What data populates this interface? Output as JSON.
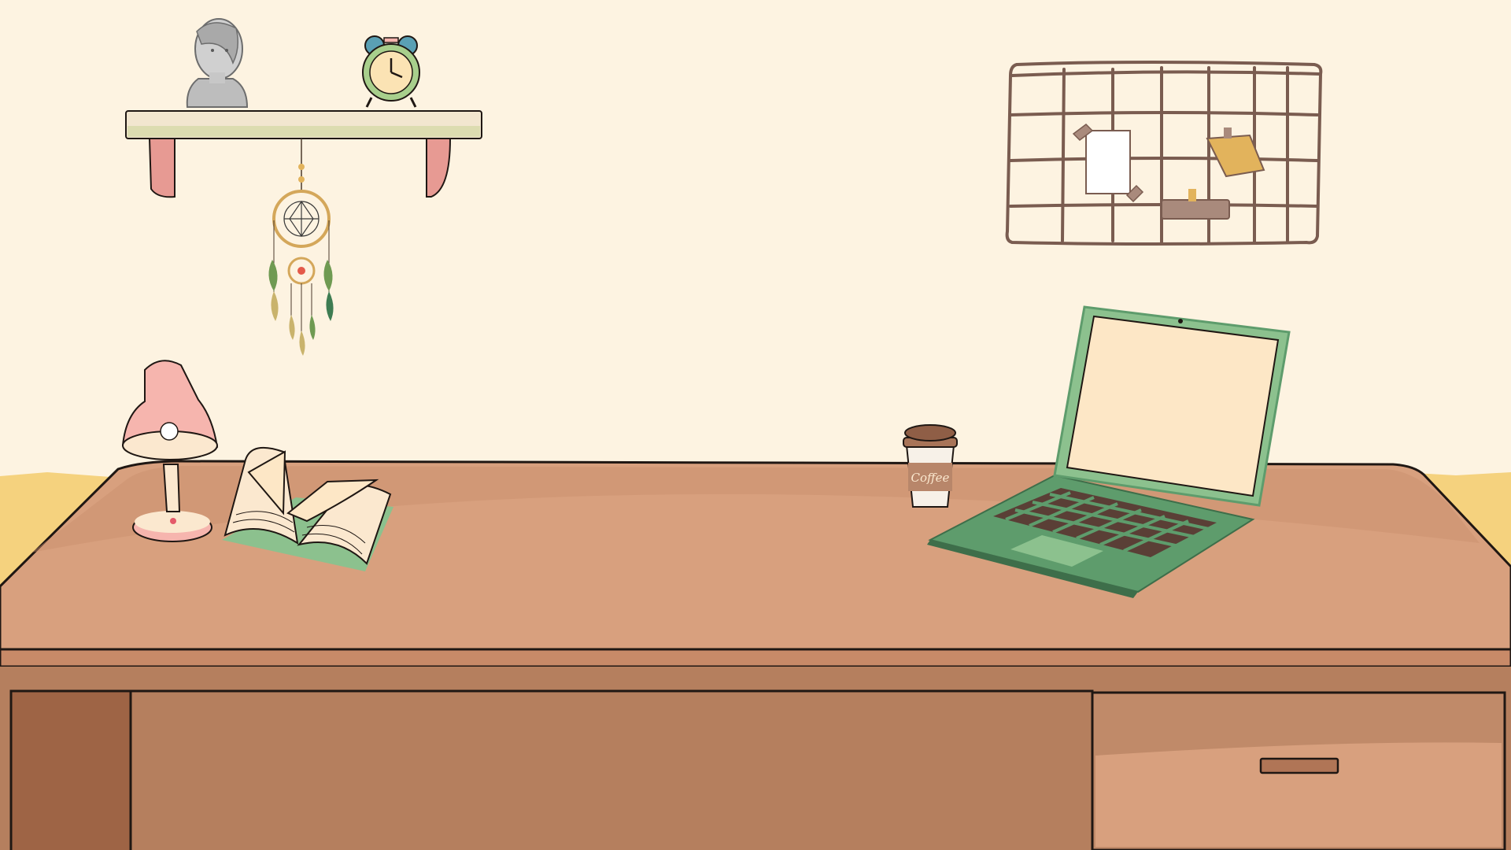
{
  "scene": {
    "type": "illustrated study desk background",
    "colors": {
      "wall": "#fdf3e1",
      "floor": "#f5d27e",
      "desk_top": "#d8a07e",
      "desk_edge": "#b47a58",
      "desk_body": "#b57f5e",
      "desk_panel_dark": "#9e6445",
      "outline": "#1f1713",
      "laptop_green": "#5e9c6c",
      "laptop_light_green": "#8cc18e",
      "screen": "#fde7c6",
      "lamp_pink": "#f6b5ae",
      "lamp_cream": "#fbe8cf",
      "bracket_pink": "#e79a93"
    },
    "objects": [
      "wall-shelf",
      "bust-statue",
      "alarm-clock",
      "dreamcatcher",
      "wire-memo-board",
      "desk-lamp",
      "open-book",
      "coffee-cup",
      "laptop",
      "desk-drawer"
    ],
    "coffee_cup_label": "Coffee"
  }
}
